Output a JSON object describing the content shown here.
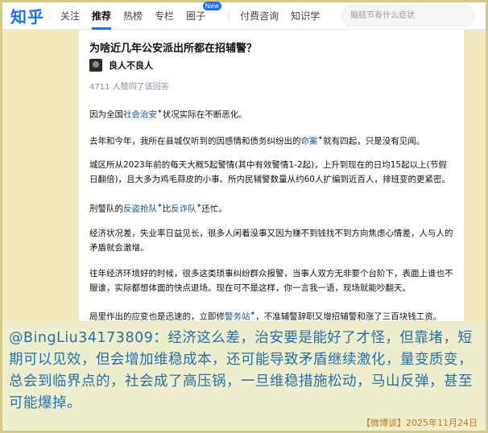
{
  "colors": {
    "accent": "#1772f6",
    "link": "#175199",
    "overlay_text": "#2a6fa6",
    "source_tag": "#c8741c"
  },
  "nav": {
    "logo": "知乎",
    "items": [
      "关注",
      "推荐",
      "热榜",
      "专栏",
      "圈子"
    ],
    "new_badge": "New",
    "items_right": [
      "付费咨询",
      "知识学"
    ],
    "search_placeholder": "脑结节有什么症状"
  },
  "question": {
    "title": "为啥近几年公安派出所都在招辅警？"
  },
  "author": {
    "name": "良人不良人",
    "avatar_icon": "avatar-icon"
  },
  "agree_count": "4711 人赞同了该回答",
  "paragraphs": {
    "p1": {
      "a": "因为全国",
      "link": "社会治安",
      "b": "状况实际在不断恶化。"
    },
    "p2": {
      "a": "去年和今年，我所在县城仅听到的因感情和债务纠纷出的",
      "link": "命案",
      "b": "就有四起，只是没有见闻。"
    },
    "p3": "城区所从2023年前的每天大概5起警情(其中有效警情1-2起)，上升到现在的日均15起以上(节假日翻倍)，且大多为鸡毛蒜皮的小事。所内民辅警数量从约60人扩编到近百人，排班变的更紧密。",
    "p4": {
      "a": "刑警队的",
      "link1": "反盗抢队",
      "mid": "比",
      "link2": "反诈队",
      "b": "还忙。"
    },
    "p5": "经济状况差，失业率日益见长，很多人闲着没事又因为赚不到钱找不到方向焦虑心情差，人与人的矛盾就会激增。",
    "p6": "往年经济环境好的时候，很多这类琐事纠纷群众报警，当事人双方无非要个台阶下，表面上谁也不服谁，实际都想体面的快点退场。现在可不是这样，你一言我一语，现场就能吵翻天。",
    "p7": {
      "a": "局里作出的应变也是迅速的，立即修",
      "link": "警务站",
      "b": "，不准辅警辞职又增招辅警和涨了三百块钱工资。"
    }
  },
  "overlay": {
    "comment": "@BingLiu34173809：经济这么差，治安要是能好了才怪，但靠堵，短期可以见效，但会增加维稳成本，还可能导致矛盾继续激化，量变质变，总会到临界点的，社会成了高压锅，一旦维稳措施松动，马山反弹，甚至可能爆掉。",
    "source": "【微博谈】2025年11月24日"
  }
}
